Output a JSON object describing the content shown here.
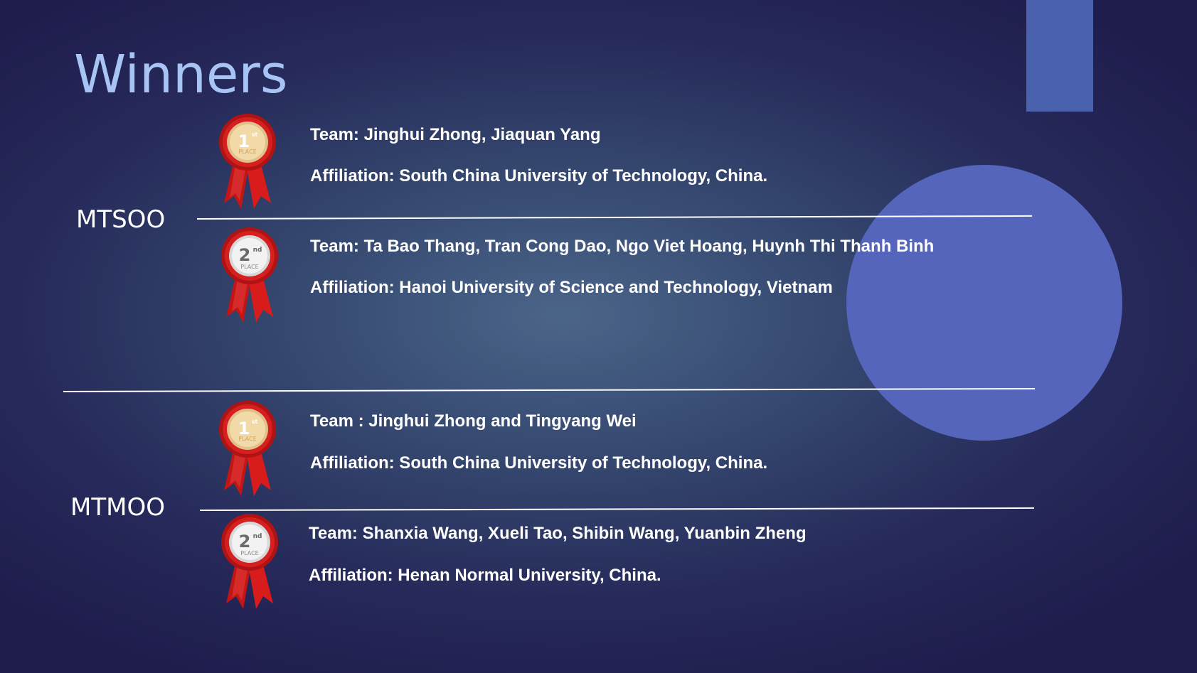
{
  "slide": {
    "title": "Winners",
    "colors": {
      "background": "#262a5a",
      "title": "#a8c4f5",
      "accent_bar": "#4a62ad",
      "circle": "#5565bb",
      "text": "#ffffff"
    }
  },
  "sections": [
    {
      "label": "MTSOO",
      "entries": [
        {
          "place_icon": "first-place-ribbon-icon",
          "place_number": "1",
          "place_suffix": "st",
          "place_word": "PLACE",
          "team": "Team:  Jinghui Zhong, Jiaquan Yang",
          "affiliation": "Affiliation: South China University of Technology, China."
        },
        {
          "place_icon": "second-place-ribbon-icon",
          "place_number": "2",
          "place_suffix": "nd",
          "place_word": "PLACE",
          "team": "Team:   Ta Bao Thang, Tran Cong Dao, Ngo Viet Hoang, Huynh Thi Thanh Binh",
          "affiliation": "Affiliation: Hanoi University of Science and Technology, Vietnam"
        }
      ]
    },
    {
      "label": "MTMOO",
      "entries": [
        {
          "place_icon": "first-place-ribbon-icon",
          "place_number": "1",
          "place_suffix": "st",
          "place_word": "PLACE",
          "team": "Team : Jinghui Zhong and Tingyang Wei",
          "affiliation": "Affiliation: South China University of Technology, China."
        },
        {
          "place_icon": "second-place-ribbon-icon",
          "place_number": "2",
          "place_suffix": "nd",
          "place_word": "PLACE",
          "team": "Team:  Shanxia Wang, Xueli Tao, Shibin Wang, Yuanbin Zheng",
          "affiliation": "Affiliation: Henan Normal University, China."
        }
      ]
    }
  ]
}
